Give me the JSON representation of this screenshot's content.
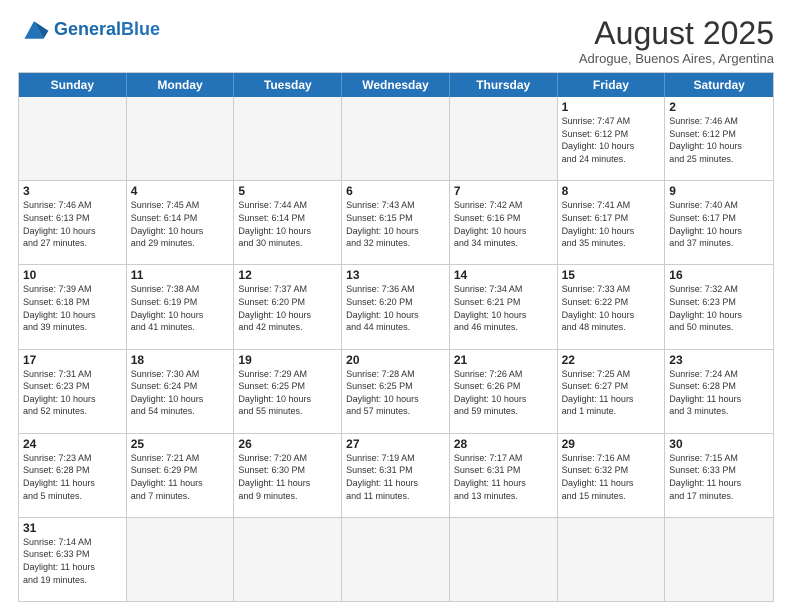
{
  "header": {
    "logo_general": "General",
    "logo_blue": "Blue",
    "title": "August 2025",
    "subtitle": "Adrogue, Buenos Aires, Argentina"
  },
  "days_of_week": [
    "Sunday",
    "Monday",
    "Tuesday",
    "Wednesday",
    "Thursday",
    "Friday",
    "Saturday"
  ],
  "weeks": [
    [
      {
        "day": "",
        "empty": true
      },
      {
        "day": "",
        "empty": true
      },
      {
        "day": "",
        "empty": true
      },
      {
        "day": "",
        "empty": true
      },
      {
        "day": "",
        "empty": true
      },
      {
        "day": "1",
        "info": "Sunrise: 7:47 AM\nSunset: 6:12 PM\nDaylight: 10 hours\nand 24 minutes."
      },
      {
        "day": "2",
        "info": "Sunrise: 7:46 AM\nSunset: 6:12 PM\nDaylight: 10 hours\nand 25 minutes."
      }
    ],
    [
      {
        "day": "3",
        "info": "Sunrise: 7:46 AM\nSunset: 6:13 PM\nDaylight: 10 hours\nand 27 minutes."
      },
      {
        "day": "4",
        "info": "Sunrise: 7:45 AM\nSunset: 6:14 PM\nDaylight: 10 hours\nand 29 minutes."
      },
      {
        "day": "5",
        "info": "Sunrise: 7:44 AM\nSunset: 6:14 PM\nDaylight: 10 hours\nand 30 minutes."
      },
      {
        "day": "6",
        "info": "Sunrise: 7:43 AM\nSunset: 6:15 PM\nDaylight: 10 hours\nand 32 minutes."
      },
      {
        "day": "7",
        "info": "Sunrise: 7:42 AM\nSunset: 6:16 PM\nDaylight: 10 hours\nand 34 minutes."
      },
      {
        "day": "8",
        "info": "Sunrise: 7:41 AM\nSunset: 6:17 PM\nDaylight: 10 hours\nand 35 minutes."
      },
      {
        "day": "9",
        "info": "Sunrise: 7:40 AM\nSunset: 6:17 PM\nDaylight: 10 hours\nand 37 minutes."
      }
    ],
    [
      {
        "day": "10",
        "info": "Sunrise: 7:39 AM\nSunset: 6:18 PM\nDaylight: 10 hours\nand 39 minutes."
      },
      {
        "day": "11",
        "info": "Sunrise: 7:38 AM\nSunset: 6:19 PM\nDaylight: 10 hours\nand 41 minutes."
      },
      {
        "day": "12",
        "info": "Sunrise: 7:37 AM\nSunset: 6:20 PM\nDaylight: 10 hours\nand 42 minutes."
      },
      {
        "day": "13",
        "info": "Sunrise: 7:36 AM\nSunset: 6:20 PM\nDaylight: 10 hours\nand 44 minutes."
      },
      {
        "day": "14",
        "info": "Sunrise: 7:34 AM\nSunset: 6:21 PM\nDaylight: 10 hours\nand 46 minutes."
      },
      {
        "day": "15",
        "info": "Sunrise: 7:33 AM\nSunset: 6:22 PM\nDaylight: 10 hours\nand 48 minutes."
      },
      {
        "day": "16",
        "info": "Sunrise: 7:32 AM\nSunset: 6:23 PM\nDaylight: 10 hours\nand 50 minutes."
      }
    ],
    [
      {
        "day": "17",
        "info": "Sunrise: 7:31 AM\nSunset: 6:23 PM\nDaylight: 10 hours\nand 52 minutes."
      },
      {
        "day": "18",
        "info": "Sunrise: 7:30 AM\nSunset: 6:24 PM\nDaylight: 10 hours\nand 54 minutes."
      },
      {
        "day": "19",
        "info": "Sunrise: 7:29 AM\nSunset: 6:25 PM\nDaylight: 10 hours\nand 55 minutes."
      },
      {
        "day": "20",
        "info": "Sunrise: 7:28 AM\nSunset: 6:25 PM\nDaylight: 10 hours\nand 57 minutes."
      },
      {
        "day": "21",
        "info": "Sunrise: 7:26 AM\nSunset: 6:26 PM\nDaylight: 10 hours\nand 59 minutes."
      },
      {
        "day": "22",
        "info": "Sunrise: 7:25 AM\nSunset: 6:27 PM\nDaylight: 11 hours\nand 1 minute."
      },
      {
        "day": "23",
        "info": "Sunrise: 7:24 AM\nSunset: 6:28 PM\nDaylight: 11 hours\nand 3 minutes."
      }
    ],
    [
      {
        "day": "24",
        "info": "Sunrise: 7:23 AM\nSunset: 6:28 PM\nDaylight: 11 hours\nand 5 minutes."
      },
      {
        "day": "25",
        "info": "Sunrise: 7:21 AM\nSunset: 6:29 PM\nDaylight: 11 hours\nand 7 minutes."
      },
      {
        "day": "26",
        "info": "Sunrise: 7:20 AM\nSunset: 6:30 PM\nDaylight: 11 hours\nand 9 minutes."
      },
      {
        "day": "27",
        "info": "Sunrise: 7:19 AM\nSunset: 6:31 PM\nDaylight: 11 hours\nand 11 minutes."
      },
      {
        "day": "28",
        "info": "Sunrise: 7:17 AM\nSunset: 6:31 PM\nDaylight: 11 hours\nand 13 minutes."
      },
      {
        "day": "29",
        "info": "Sunrise: 7:16 AM\nSunset: 6:32 PM\nDaylight: 11 hours\nand 15 minutes."
      },
      {
        "day": "30",
        "info": "Sunrise: 7:15 AM\nSunset: 6:33 PM\nDaylight: 11 hours\nand 17 minutes."
      }
    ],
    [
      {
        "day": "31",
        "info": "Sunrise: 7:14 AM\nSunset: 6:33 PM\nDaylight: 11 hours\nand 19 minutes."
      },
      {
        "day": "",
        "empty": true
      },
      {
        "day": "",
        "empty": true
      },
      {
        "day": "",
        "empty": true
      },
      {
        "day": "",
        "empty": true
      },
      {
        "day": "",
        "empty": true
      },
      {
        "day": "",
        "empty": true
      }
    ]
  ]
}
